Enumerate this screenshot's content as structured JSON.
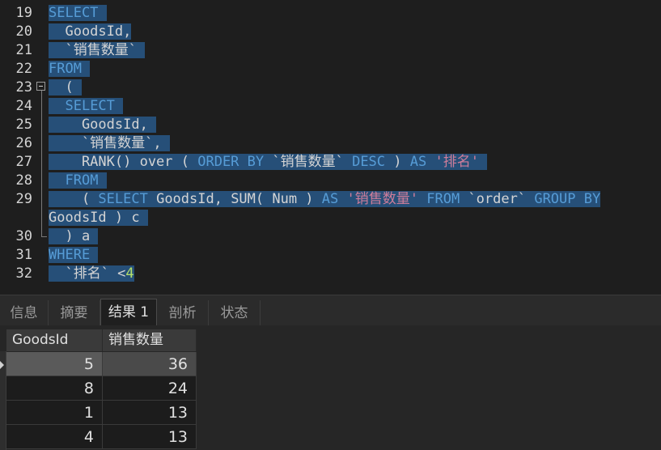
{
  "editor": {
    "line_numbers": [
      "19",
      "20",
      "21",
      "22",
      "23",
      "24",
      "25",
      "26",
      "27",
      "28",
      "29",
      "30",
      "31",
      "32"
    ],
    "lines": [
      {
        "segments": [
          {
            "t": "SELECT",
            "c": "kw"
          },
          {
            "t": " ",
            "c": ""
          }
        ]
      },
      {
        "segments": [
          {
            "t": "  GoodsId,",
            "c": ""
          }
        ]
      },
      {
        "segments": [
          {
            "t": "  `销售数量`",
            "c": ""
          },
          {
            "t": " ",
            "c": ""
          }
        ]
      },
      {
        "segments": [
          {
            "t": "FROM",
            "c": "kw"
          },
          {
            "t": " ",
            "c": ""
          }
        ]
      },
      {
        "segments": [
          {
            "t": "  (",
            "c": ""
          },
          {
            "t": " ",
            "c": ""
          }
        ]
      },
      {
        "segments": [
          {
            "t": "  ",
            "c": ""
          },
          {
            "t": "SELECT",
            "c": "kw"
          },
          {
            "t": " ",
            "c": ""
          }
        ]
      },
      {
        "segments": [
          {
            "t": "    GoodsId,",
            "c": ""
          },
          {
            "t": " ",
            "c": ""
          }
        ]
      },
      {
        "segments": [
          {
            "t": "    `销售数量`,",
            "c": ""
          },
          {
            "t": " ",
            "c": ""
          }
        ]
      },
      {
        "segments": [
          {
            "t": "    RANK() over ( ",
            "c": ""
          },
          {
            "t": "ORDER BY",
            "c": "kw"
          },
          {
            "t": " `销售数量` ",
            "c": ""
          },
          {
            "t": "DESC",
            "c": "kw"
          },
          {
            "t": " ) ",
            "c": ""
          },
          {
            "t": "AS",
            "c": "kw"
          },
          {
            "t": " ",
            "c": ""
          },
          {
            "t": "'排名'",
            "c": "str"
          },
          {
            "t": " ",
            "c": ""
          }
        ]
      },
      {
        "segments": [
          {
            "t": "  ",
            "c": ""
          },
          {
            "t": "FROM",
            "c": "kw"
          },
          {
            "t": " ",
            "c": ""
          }
        ]
      },
      {
        "segments": [
          {
            "t": "    ( ",
            "c": ""
          },
          {
            "t": "SELECT",
            "c": "kw"
          },
          {
            "t": " GoodsId, SUM( Num ) ",
            "c": ""
          },
          {
            "t": "AS",
            "c": "kw"
          },
          {
            "t": " ",
            "c": ""
          },
          {
            "t": "'销售数量'",
            "c": "str"
          },
          {
            "t": " ",
            "c": ""
          },
          {
            "t": "FROM",
            "c": "kw"
          },
          {
            "t": " `order` ",
            "c": ""
          },
          {
            "t": "GROUP BY",
            "c": "kw"
          }
        ]
      },
      {
        "segments": [
          {
            "t": "GoodsId ) c ",
            "c": ""
          }
        ]
      },
      {
        "segments": [
          {
            "t": "  ) a ",
            "c": ""
          }
        ]
      },
      {
        "segments": [
          {
            "t": "WHERE",
            "c": "kw"
          },
          {
            "t": " ",
            "c": ""
          }
        ]
      },
      {
        "segments": [
          {
            "t": "  `排名` <",
            "c": ""
          },
          {
            "t": "4",
            "c": "num"
          }
        ]
      }
    ]
  },
  "tabs": [
    {
      "label": "信息",
      "active": false
    },
    {
      "label": "摘要",
      "active": false
    },
    {
      "label": "结果 1",
      "active": true
    },
    {
      "label": "剖析",
      "active": false
    },
    {
      "label": "状态",
      "active": false
    }
  ],
  "grid": {
    "columns": [
      "GoodsId",
      "销售数量"
    ],
    "rows": [
      [
        "5",
        "36"
      ],
      [
        "8",
        "24"
      ],
      [
        "1",
        "13"
      ],
      [
        "4",
        "13"
      ]
    ]
  }
}
